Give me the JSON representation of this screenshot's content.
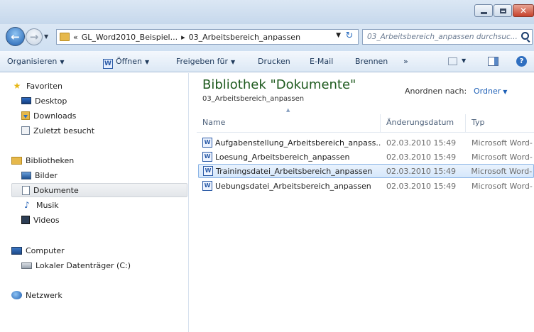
{
  "address": {
    "crumbs": [
      "«",
      "GL_Word2010_Beispiel...",
      "03_Arbeitsbereich_anpassen"
    ],
    "search_placeholder": "03_Arbeitsbereich_anpassen durchsuc..."
  },
  "toolbar": {
    "organize": "Organisieren",
    "open": "Öffnen",
    "share": "Freigeben für",
    "print": "Drucken",
    "email": "E-Mail",
    "burn": "Brennen",
    "more": "»"
  },
  "sidebar": {
    "favorites": {
      "label": "Favoriten",
      "items": [
        "Desktop",
        "Downloads",
        "Zuletzt besucht"
      ]
    },
    "libraries": {
      "label": "Bibliotheken",
      "items": [
        "Bilder",
        "Dokumente",
        "Musik",
        "Videos"
      ]
    },
    "computer": {
      "label": "Computer",
      "items": [
        "Lokaler Datenträger (C:)"
      ]
    },
    "network": "Netzwerk"
  },
  "main": {
    "library_title": "Bibliothek \"Dokumente\"",
    "library_subtitle": "03_Arbeitsbereich_anpassen",
    "arrange_label": "Anordnen nach:",
    "arrange_value": "Ordner",
    "columns": {
      "name": "Name",
      "date": "Änderungsdatum",
      "type": "Typ"
    },
    "files": [
      {
        "name": "Aufgabenstellung_Arbeitsbereich_anpass...",
        "date": "02.03.2010 15:49",
        "type": "Microsoft Word-"
      },
      {
        "name": "Loesung_Arbeitsbereich_anpassen",
        "date": "02.03.2010 15:49",
        "type": "Microsoft Word-"
      },
      {
        "name": "Trainingsdatei_Arbeitsbereich_anpassen",
        "date": "02.03.2010 15:49",
        "type": "Microsoft Word-"
      },
      {
        "name": "Uebungsdatei_Arbeitsbereich_anpassen",
        "date": "02.03.2010 15:49",
        "type": "Microsoft Word-"
      }
    ]
  },
  "icons": {
    "window_minimize": "minimize-icon",
    "window_maximize": "maximize-icon",
    "window_close": "close-icon",
    "file": "word-document-icon"
  },
  "colors": {
    "accent": "#1d5fb6",
    "library_title": "#1e5a1e",
    "selection": "#d5e7fb"
  }
}
